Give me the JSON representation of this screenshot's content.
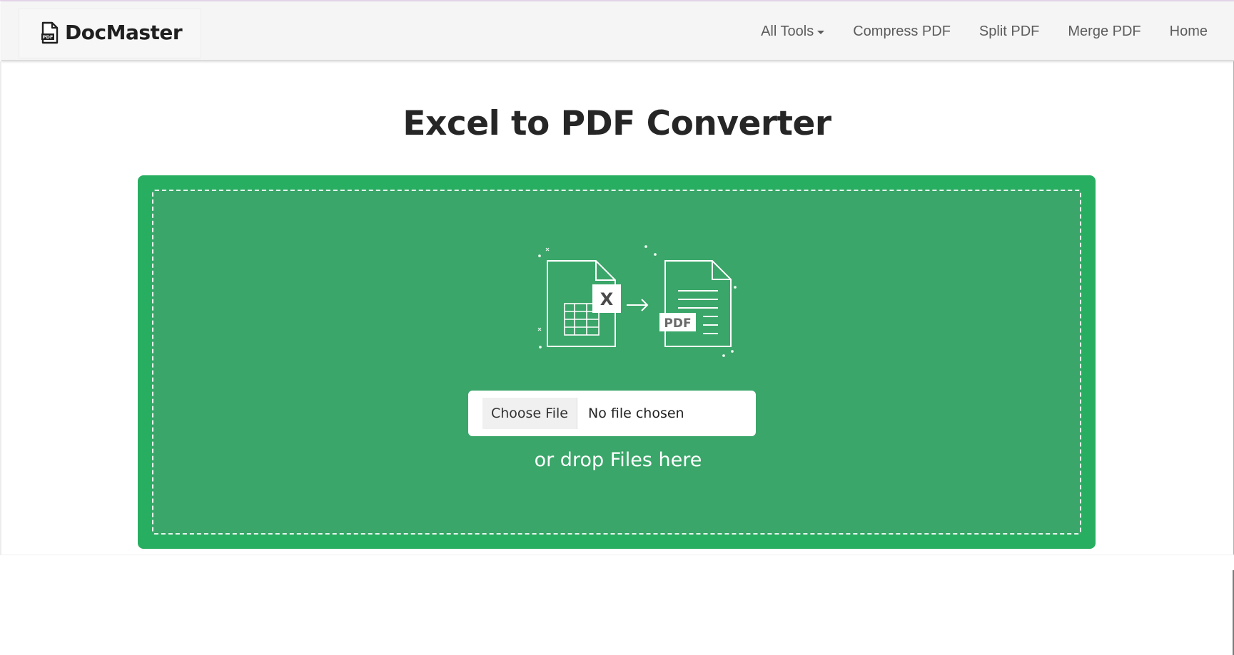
{
  "brand": {
    "name": "DocMaster",
    "icon": "pdf-file-icon",
    "icon_label": "PDF"
  },
  "nav": {
    "all_tools": "All Tools",
    "compress": "Compress PDF",
    "split": "Split PDF",
    "merge": "Merge PDF",
    "home": "Home"
  },
  "main": {
    "title": "Excel to PDF Converter"
  },
  "upload": {
    "choose_label": "Choose File",
    "file_status": "No file chosen",
    "drop_hint": "or drop Files here",
    "illustration": {
      "source_icon": "excel-file-icon",
      "source_badge": "X",
      "arrow_icon": "arrow-right-icon",
      "target_icon": "pdf-document-icon",
      "target_badge": "PDF"
    }
  },
  "colors": {
    "dropzone_outer": "#27ae60",
    "dropzone_inner": "#3aa669",
    "navbar_bg": "#f5f5f5",
    "title_text": "#262626"
  }
}
